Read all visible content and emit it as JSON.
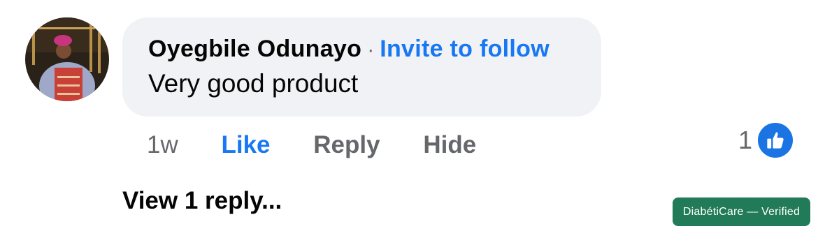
{
  "comment": {
    "author": "Oyegbile Odunayo",
    "separator": "·",
    "invite_label": "Invite to follow",
    "text": "Very good product"
  },
  "actions": {
    "timestamp": "1w",
    "like_label": "Like",
    "reply_label": "Reply",
    "hide_label": "Hide"
  },
  "reactions": {
    "count": "1",
    "icon": "thumbs-up-icon"
  },
  "view_replies_label": "View 1 reply...",
  "badge": {
    "text": "DiabétiCare — Verified"
  },
  "colors": {
    "accent": "#1877f2",
    "bubble": "#f0f2f5",
    "secondary_text": "#65676b",
    "badge": "#217b58"
  }
}
